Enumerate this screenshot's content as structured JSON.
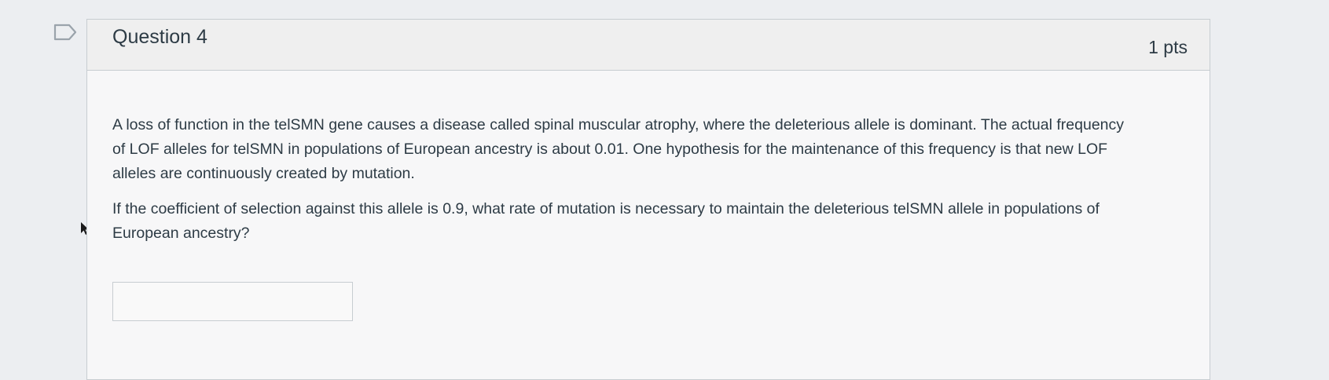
{
  "question": {
    "title": "Question 4",
    "points": "1 pts",
    "paragraphs": [
      "A loss of function in the telSMN gene causes a disease called spinal muscular atrophy, where the deleterious allele is dominant. The actual frequency of LOF alleles for telSMN in populations of European ancestry is about 0.01. One hypothesis for the maintenance of this frequency is that new LOF alleles are continuously created by mutation.",
      "If the coefficient of selection against this allele is 0.9, what rate of mutation is necessary to maintain the deleterious telSMN allele in populations of European ancestry?"
    ],
    "answer": {
      "value": "",
      "placeholder": ""
    }
  },
  "icons": {
    "flag": "flag-outline-icon",
    "cursor": "mouse-pointer-icon"
  },
  "colors": {
    "page_background": "#eceef1",
    "card_background": "#f7f7f8",
    "header_background": "#efefef",
    "border": "#c7cdd1",
    "text": "#2d3b45"
  }
}
